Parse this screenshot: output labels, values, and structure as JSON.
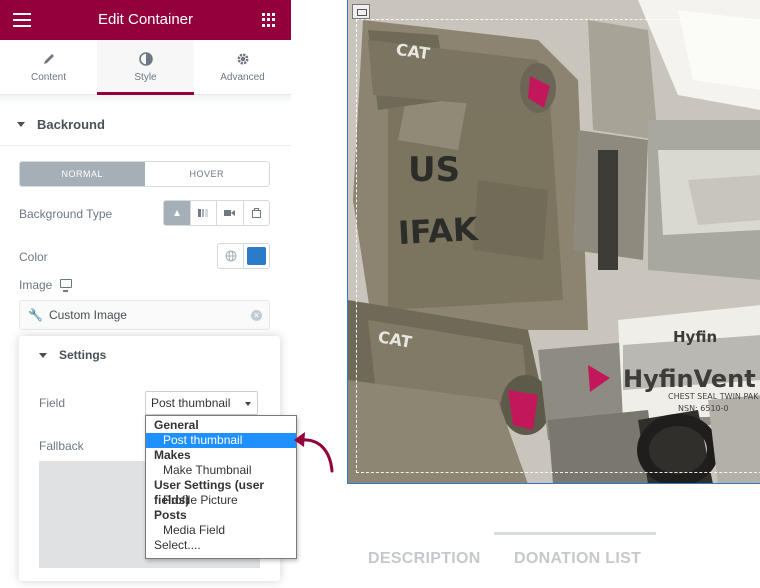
{
  "topbar": {
    "title": "Edit Container",
    "menu_icon": "hamburger-icon",
    "apps_icon": "grid-icon",
    "color": "#93003c"
  },
  "tabs": [
    {
      "label": "Content",
      "icon": "pencil-icon",
      "active": false
    },
    {
      "label": "Style",
      "icon": "contrast-icon",
      "active": true
    },
    {
      "label": "Advanced",
      "icon": "gear-icon",
      "active": false
    }
  ],
  "section": {
    "title": "Backround"
  },
  "state_switch": {
    "normal": "NORMAL",
    "hover": "HOVER",
    "selected": "NORMAL"
  },
  "background_type": {
    "label": "Background Type",
    "options": [
      "classic-icon",
      "gradient-icon",
      "video-icon",
      "slideshow-icon"
    ],
    "selected": "classic-icon"
  },
  "color": {
    "label": "Color",
    "value": "#2b7bc8"
  },
  "image": {
    "label": "Image",
    "custom_label": "Custom Image"
  },
  "settings": {
    "title": "Settings",
    "field_label": "Field",
    "field_value": "Post thumbnail",
    "fallback_label": "Fallback"
  },
  "dropdown": {
    "groups": [
      {
        "group": "General",
        "options": [
          "Post thumbnail"
        ]
      },
      {
        "group": "Makes",
        "options": [
          "Make Thumbnail"
        ]
      },
      {
        "group": "User Settings (user fields)",
        "options": [
          "Profile Picture"
        ]
      },
      {
        "group": "Posts",
        "options": [
          "Media Field"
        ]
      }
    ],
    "selected": "Post thumbnail",
    "footer": "Select...."
  },
  "photo_text": {
    "us": "US",
    "ifak": "IFAK",
    "cat1": "CAT",
    "cat2": "CAT",
    "hyfin": "Hyfin",
    "hyfin2": "HyfinVent",
    "chest": "CHEST SEAL TWIN PAK",
    "nsn": "NSN: 6510-0"
  },
  "content_tabs": {
    "description": "DESCRIPTION",
    "donation": "DONATION LIST"
  }
}
